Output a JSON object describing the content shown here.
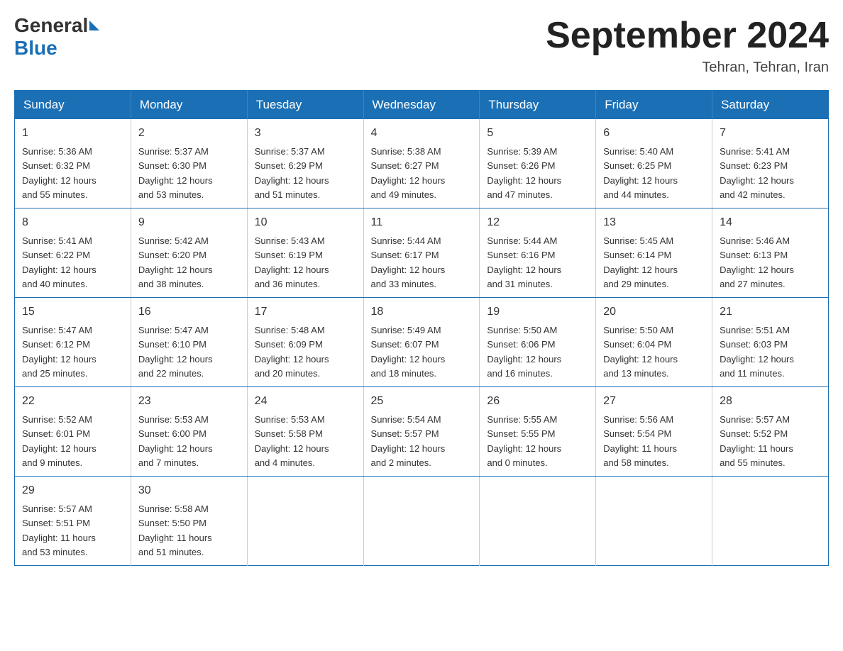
{
  "header": {
    "logo_general": "General",
    "logo_blue": "Blue",
    "month_title": "September 2024",
    "location": "Tehran, Tehran, Iran"
  },
  "weekdays": [
    "Sunday",
    "Monday",
    "Tuesday",
    "Wednesday",
    "Thursday",
    "Friday",
    "Saturday"
  ],
  "weeks": [
    [
      {
        "day": "1",
        "sunrise": "5:36 AM",
        "sunset": "6:32 PM",
        "daylight": "12 hours and 55 minutes."
      },
      {
        "day": "2",
        "sunrise": "5:37 AM",
        "sunset": "6:30 PM",
        "daylight": "12 hours and 53 minutes."
      },
      {
        "day": "3",
        "sunrise": "5:37 AM",
        "sunset": "6:29 PM",
        "daylight": "12 hours and 51 minutes."
      },
      {
        "day": "4",
        "sunrise": "5:38 AM",
        "sunset": "6:27 PM",
        "daylight": "12 hours and 49 minutes."
      },
      {
        "day": "5",
        "sunrise": "5:39 AM",
        "sunset": "6:26 PM",
        "daylight": "12 hours and 47 minutes."
      },
      {
        "day": "6",
        "sunrise": "5:40 AM",
        "sunset": "6:25 PM",
        "daylight": "12 hours and 44 minutes."
      },
      {
        "day": "7",
        "sunrise": "5:41 AM",
        "sunset": "6:23 PM",
        "daylight": "12 hours and 42 minutes."
      }
    ],
    [
      {
        "day": "8",
        "sunrise": "5:41 AM",
        "sunset": "6:22 PM",
        "daylight": "12 hours and 40 minutes."
      },
      {
        "day": "9",
        "sunrise": "5:42 AM",
        "sunset": "6:20 PM",
        "daylight": "12 hours and 38 minutes."
      },
      {
        "day": "10",
        "sunrise": "5:43 AM",
        "sunset": "6:19 PM",
        "daylight": "12 hours and 36 minutes."
      },
      {
        "day": "11",
        "sunrise": "5:44 AM",
        "sunset": "6:17 PM",
        "daylight": "12 hours and 33 minutes."
      },
      {
        "day": "12",
        "sunrise": "5:44 AM",
        "sunset": "6:16 PM",
        "daylight": "12 hours and 31 minutes."
      },
      {
        "day": "13",
        "sunrise": "5:45 AM",
        "sunset": "6:14 PM",
        "daylight": "12 hours and 29 minutes."
      },
      {
        "day": "14",
        "sunrise": "5:46 AM",
        "sunset": "6:13 PM",
        "daylight": "12 hours and 27 minutes."
      }
    ],
    [
      {
        "day": "15",
        "sunrise": "5:47 AM",
        "sunset": "6:12 PM",
        "daylight": "12 hours and 25 minutes."
      },
      {
        "day": "16",
        "sunrise": "5:47 AM",
        "sunset": "6:10 PM",
        "daylight": "12 hours and 22 minutes."
      },
      {
        "day": "17",
        "sunrise": "5:48 AM",
        "sunset": "6:09 PM",
        "daylight": "12 hours and 20 minutes."
      },
      {
        "day": "18",
        "sunrise": "5:49 AM",
        "sunset": "6:07 PM",
        "daylight": "12 hours and 18 minutes."
      },
      {
        "day": "19",
        "sunrise": "5:50 AM",
        "sunset": "6:06 PM",
        "daylight": "12 hours and 16 minutes."
      },
      {
        "day": "20",
        "sunrise": "5:50 AM",
        "sunset": "6:04 PM",
        "daylight": "12 hours and 13 minutes."
      },
      {
        "day": "21",
        "sunrise": "5:51 AM",
        "sunset": "6:03 PM",
        "daylight": "12 hours and 11 minutes."
      }
    ],
    [
      {
        "day": "22",
        "sunrise": "5:52 AM",
        "sunset": "6:01 PM",
        "daylight": "12 hours and 9 minutes."
      },
      {
        "day": "23",
        "sunrise": "5:53 AM",
        "sunset": "6:00 PM",
        "daylight": "12 hours and 7 minutes."
      },
      {
        "day": "24",
        "sunrise": "5:53 AM",
        "sunset": "5:58 PM",
        "daylight": "12 hours and 4 minutes."
      },
      {
        "day": "25",
        "sunrise": "5:54 AM",
        "sunset": "5:57 PM",
        "daylight": "12 hours and 2 minutes."
      },
      {
        "day": "26",
        "sunrise": "5:55 AM",
        "sunset": "5:55 PM",
        "daylight": "12 hours and 0 minutes."
      },
      {
        "day": "27",
        "sunrise": "5:56 AM",
        "sunset": "5:54 PM",
        "daylight": "11 hours and 58 minutes."
      },
      {
        "day": "28",
        "sunrise": "5:57 AM",
        "sunset": "5:52 PM",
        "daylight": "11 hours and 55 minutes."
      }
    ],
    [
      {
        "day": "29",
        "sunrise": "5:57 AM",
        "sunset": "5:51 PM",
        "daylight": "11 hours and 53 minutes."
      },
      {
        "day": "30",
        "sunrise": "5:58 AM",
        "sunset": "5:50 PM",
        "daylight": "11 hours and 51 minutes."
      },
      null,
      null,
      null,
      null,
      null
    ]
  ],
  "labels": {
    "sunrise": "Sunrise:",
    "sunset": "Sunset:",
    "daylight": "Daylight:"
  }
}
